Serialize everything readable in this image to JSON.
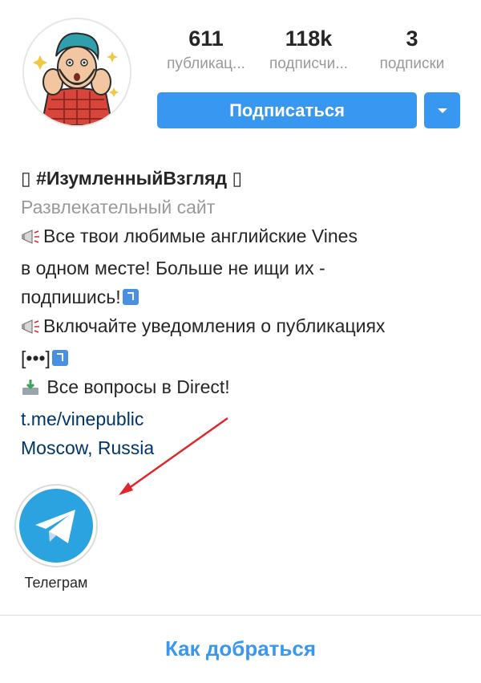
{
  "profile": {
    "stats": [
      {
        "value": "611",
        "label": "публикац..."
      },
      {
        "value": "118k",
        "label": "подписчи..."
      },
      {
        "value": "3",
        "label": "подписки"
      }
    ],
    "follow_label": "Подписаться",
    "dropdown_icon": "chevron-down-icon"
  },
  "bio": {
    "title": "#ИзумленныйВзгляд",
    "title_box_left": "▯",
    "title_box_right": "▯",
    "category": "Развлекательный сайт",
    "lines": [
      "Все твои любимые английские Vines",
      "в одном месте! Больше не ищи их -",
      "подпишись!",
      "Включайте уведомления о публикациях",
      "[•••]",
      " Все вопросы в Direct!"
    ],
    "link": "t.me/vinepublic",
    "location": "Moscow, Russia"
  },
  "highlights": [
    {
      "label": "Телеграм",
      "icon": "telegram-icon",
      "color": "#2aa3e0"
    }
  ],
  "directions_label": "Как добраться",
  "colors": {
    "accent": "#3897f0",
    "link": "#003569",
    "arrow": "#e0262b"
  }
}
